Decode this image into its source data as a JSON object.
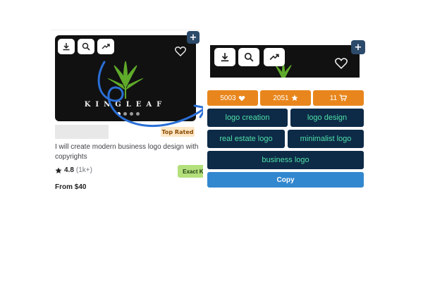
{
  "gig_card": {
    "thumbnail_brand_text": "KINGLEAF",
    "badge": "Top Rated",
    "title": "I will create modern business logo design with copyrights",
    "rating": "4.8",
    "rating_count": "(1k+)",
    "match_label": "Exact Keyword Match",
    "price": "From $40",
    "toolbar_icons": [
      "download-icon",
      "search-icon",
      "trending-icon"
    ]
  },
  "panel": {
    "toolbar_icons": [
      "download-icon",
      "search-icon",
      "trending-icon"
    ],
    "stats": [
      {
        "value": "5003",
        "icon": "heart-icon"
      },
      {
        "value": "2051",
        "icon": "star-icon"
      },
      {
        "value": "11",
        "icon": "cart-icon"
      }
    ],
    "tags": [
      "logo creation",
      "logo design",
      "real estate logo",
      "minimalist logo",
      "business logo"
    ],
    "copy_label": "Copy"
  },
  "colors": {
    "accent_orange": "#e8861d",
    "tag_bg": "#0d2a47",
    "tag_text": "#4fe0a8",
    "copy_blue": "#3288cf",
    "arrow_blue": "#2a6fd6",
    "match_green": "#b4e07c"
  }
}
